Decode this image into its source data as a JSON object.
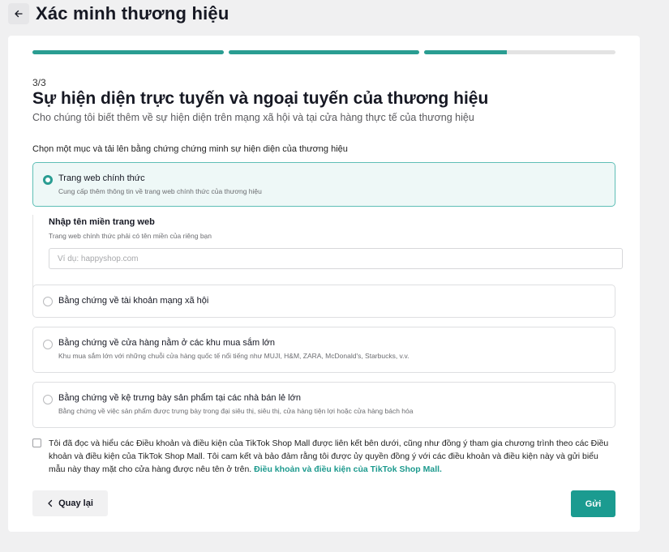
{
  "header": {
    "title": "Xác minh thương hiệu"
  },
  "progress": {
    "steps": 3,
    "fills": [
      1,
      1,
      0.43
    ]
  },
  "form": {
    "step_label": "3/3",
    "heading": "Sự hiện diện trực tuyến và ngoại tuyến của thương hiệu",
    "subheading": "Cho chúng tôi biết thêm về sự hiện diện trên mạng xã hội và tại cửa hàng thực tế của thương hiệu",
    "instruction": "Chọn một mục và tải lên bằng chứng chứng minh sự hiện diện của thương hiệu",
    "options": [
      {
        "title": "Trang web chính thức",
        "desc": "Cung cấp thêm thông tin về trang web chính thức của thương hiệu",
        "selected": true
      },
      {
        "title": "Bằng chứng về tài khoản mạng xã hội",
        "desc": "",
        "selected": false
      },
      {
        "title": "Bằng chứng về cửa hàng nằm ở các khu mua sắm lớn",
        "desc": "Khu mua sắm lớn với những chuỗi cửa hàng quốc tế nổi tiếng như MUJI, H&M, ZARA, McDonald's, Starbucks, v.v.",
        "selected": false
      },
      {
        "title": "Bằng chứng về kệ trưng bày sản phẩm tại các nhà bán lẻ lớn",
        "desc": "Bằng chứng về việc sản phẩm được trưng bày trong đại siêu thị, siêu thị, cửa hàng tiện lợi hoặc cửa hàng bách hóa",
        "selected": false
      }
    ],
    "domain_field": {
      "label": "Nhập tên miền trang web",
      "hint": "Trang web chính thức phải có tên miền của riêng bạn",
      "placeholder": "Ví dụ: happyshop.com",
      "value": ""
    },
    "terms": {
      "text": "Tôi đã đọc và hiểu các Điều khoản và điều kiện của TikTok Shop Mall được liên kết bên dưới, cũng như đồng ý tham gia chương trình theo các Điều khoản và điều kiện của TikTok Shop Mall. Tôi cam kết và bảo đảm rằng tôi được ủy quyền đồng ý với các điều khoản và điều kiện này và gửi biểu mẫu này thay mặt cho cửa hàng được nêu tên ở trên.",
      "link": "Điều khoản và điều kiện của TikTok Shop Mall.",
      "checked": false
    },
    "buttons": {
      "back": "Quay lại",
      "submit": "Gửi"
    }
  },
  "colors": {
    "accent": "#1b9b90",
    "selected_bg": "#eef8f7",
    "page_bg": "#f0f0f1"
  }
}
